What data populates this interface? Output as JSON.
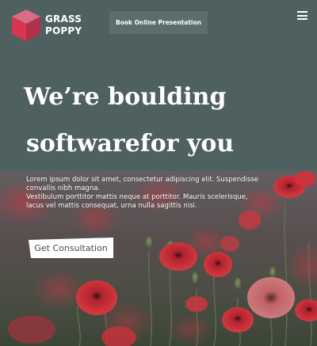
{
  "logo": {
    "line1": "GRASS",
    "line2": "POPPY"
  },
  "header": {
    "book_button_label": "Book Online Presentation",
    "menu_icon": "hamburger-menu-icon"
  },
  "hero": {
    "headline_line1": "We’re boulding",
    "headline_line2": "softwarefor you",
    "description_line1": "Lorem ipsum dolor sit amet, consectetur adipiscing elit. Suspendisse convallis nibh magna.",
    "description_line2": "Vestibulum porttitor mattis neque at porttitor. Mauris scelerisque, lacus vel mattis consequat, urna nulla sagittis nisi.",
    "cta_label": "Get Consultation"
  },
  "colors": {
    "header_bg": "#4f6060",
    "button_bg": "#5b6d6c",
    "logo_red": "#e0344f",
    "logo_pink": "#c9546f",
    "poppy_red": "#e8333e"
  }
}
